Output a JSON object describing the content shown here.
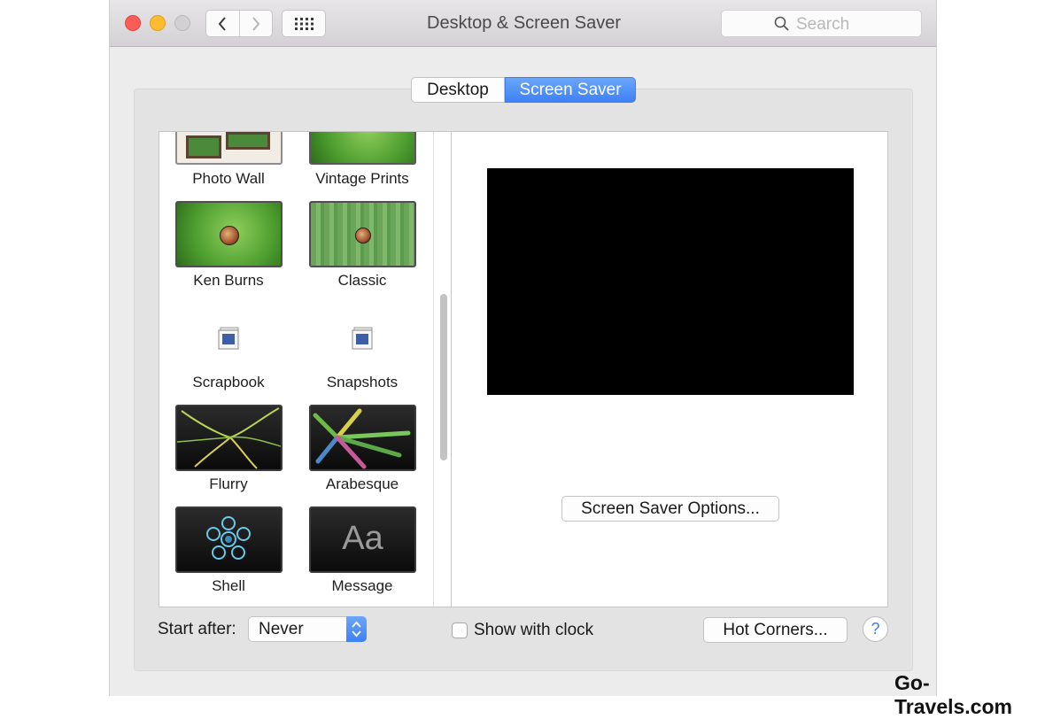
{
  "window": {
    "title": "Desktop & Screen Saver",
    "search_placeholder": "Search"
  },
  "tabs": [
    {
      "label": "Desktop",
      "active": false
    },
    {
      "label": "Screen Saver",
      "active": true
    }
  ],
  "screen_savers": [
    {
      "label": "Photo Wall"
    },
    {
      "label": "Vintage Prints"
    },
    {
      "label": "Ken Burns"
    },
    {
      "label": "Classic"
    },
    {
      "label": "Scrapbook"
    },
    {
      "label": "Snapshots"
    },
    {
      "label": "Flurry"
    },
    {
      "label": "Arabesque"
    },
    {
      "label": "Shell"
    },
    {
      "label": "Message",
      "thumb_text": "Aa"
    }
  ],
  "preview": {
    "options_button": "Screen Saver Options..."
  },
  "footer": {
    "start_after_label": "Start after:",
    "start_after_value": "Never",
    "show_clock_label": "Show with clock",
    "show_clock_checked": false,
    "hot_corners_button": "Hot Corners...",
    "help_label": "?"
  },
  "watermark": "Go-Travels.com",
  "colors": {
    "accent": "#3d81f5",
    "close": "#fc5b57",
    "minimize": "#fdbc2e"
  }
}
